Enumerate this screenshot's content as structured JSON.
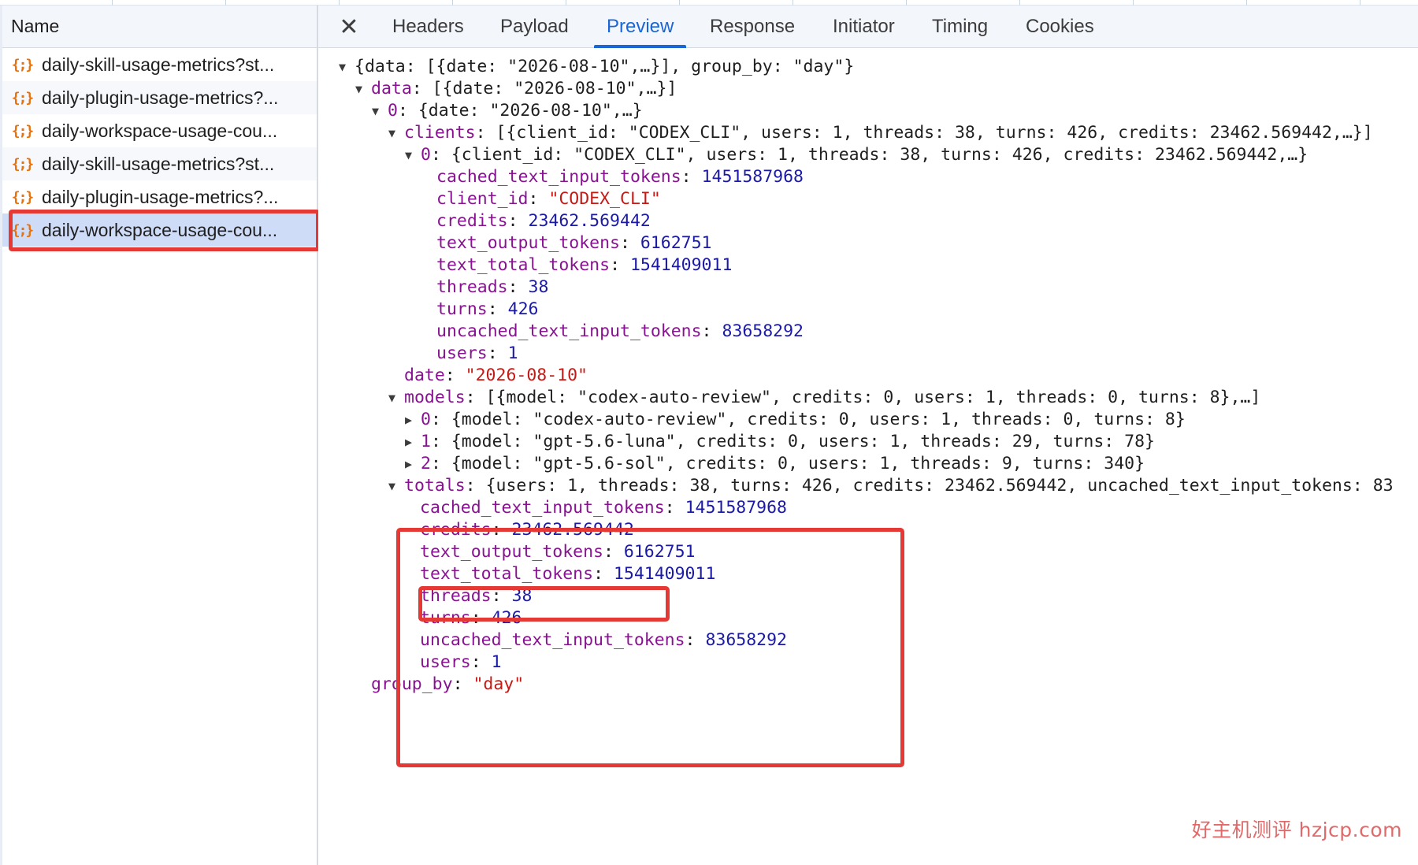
{
  "name_panel": {
    "header": "Name",
    "requests": [
      {
        "label": "daily-skill-usage-metrics?st..."
      },
      {
        "label": "daily-plugin-usage-metrics?..."
      },
      {
        "label": "daily-workspace-usage-cou..."
      },
      {
        "label": "daily-skill-usage-metrics?st..."
      },
      {
        "label": "daily-plugin-usage-metrics?..."
      },
      {
        "label": "daily-workspace-usage-cou...",
        "selected": true
      }
    ],
    "request_icon": "json-brace-icon"
  },
  "tabs": {
    "close_icon": "close-icon",
    "items": [
      "Headers",
      "Payload",
      "Preview",
      "Response",
      "Initiator",
      "Timing",
      "Cookies"
    ],
    "active": "Preview"
  },
  "preview": {
    "l0": "{data: [{date: \"2026-08-10\",…}], group_by: \"day\"}",
    "l1_key": "data",
    "l1_sum": "[{date: \"2026-08-10\",…}]",
    "l2_key": "0",
    "l2_sum": "{date: \"2026-08-10\",…}",
    "l3_key": "clients",
    "l3_sum": "[{client_id: \"CODEX_CLI\", users: 1, threads: 38, turns: 426, credits: 23462.569442,…}]",
    "l4_key": "0",
    "l4_sum": "{client_id: \"CODEX_CLI\", users: 1, threads: 38, turns: 426, credits: 23462.569442,…}",
    "client_fields": [
      {
        "k": "cached_text_input_tokens",
        "v": "1451587968"
      },
      {
        "k": "client_id",
        "v": "\"CODEX_CLI\""
      },
      {
        "k": "credits",
        "v": "23462.569442"
      },
      {
        "k": "text_output_tokens",
        "v": "6162751"
      },
      {
        "k": "text_total_tokens",
        "v": "1541409011"
      },
      {
        "k": "threads",
        "v": "38"
      },
      {
        "k": "turns",
        "v": "426"
      },
      {
        "k": "uncached_text_input_tokens",
        "v": "83658292"
      },
      {
        "k": "users",
        "v": "1"
      }
    ],
    "date_key": "date",
    "date_val": "\"2026-08-10\"",
    "models_key": "models",
    "models_sum": "[{model: \"codex-auto-review\", credits: 0, users: 1, threads: 0, turns: 8},…]",
    "models": [
      {
        "k": "0",
        "sum": "{model: \"codex-auto-review\", credits: 0, users: 1, threads: 0, turns: 8}"
      },
      {
        "k": "1",
        "sum": "{model: \"gpt-5.6-luna\", credits: 0, users: 1, threads: 29, turns: 78}"
      },
      {
        "k": "2",
        "sum": "{model: \"gpt-5.6-sol\", credits: 0, users: 1, threads: 9, turns: 340}"
      }
    ],
    "totals_key": "totals",
    "totals_sum": "{users: 1, threads: 38, turns: 426, credits: 23462.569442, uncached_text_input_tokens: 83",
    "totals_fields": [
      {
        "k": "cached_text_input_tokens",
        "v": "1451587968"
      },
      {
        "k": "credits",
        "v": "23462.569442"
      },
      {
        "k": "text_output_tokens",
        "v": "6162751"
      },
      {
        "k": "text_total_tokens",
        "v": "1541409011"
      },
      {
        "k": "threads",
        "v": "38"
      },
      {
        "k": "turns",
        "v": "426"
      },
      {
        "k": "uncached_text_input_tokens",
        "v": "83658292"
      },
      {
        "k": "users",
        "v": "1"
      }
    ],
    "group_by_key": "group_by",
    "group_by_val": "\"day\""
  },
  "watermark": "好主机测评 hzjcp.com",
  "colors": {
    "accent": "#1a66d6",
    "highlight": "#e53935",
    "json_key": "#881391",
    "json_string": "#c41a16",
    "json_number": "#1a1aa6",
    "request_icon": "#e8710a"
  }
}
